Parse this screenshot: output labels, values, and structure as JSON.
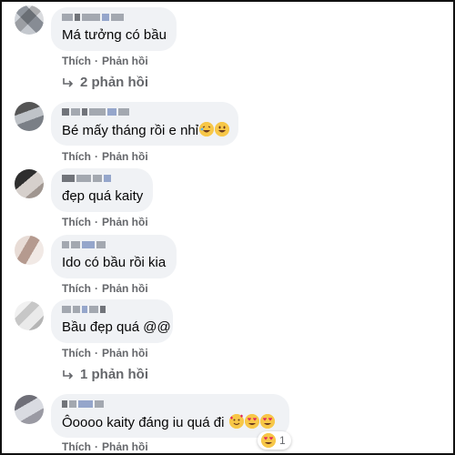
{
  "comments": [
    {
      "text": "Má tưởng có bầu",
      "like": "Thích",
      "reply": "Phản hồi",
      "replies": "2 phản hồi"
    },
    {
      "text": "Bé mấy tháng rồi e nhỉ",
      "like": "Thích",
      "reply": "Phản hồi"
    },
    {
      "text": "đẹp quá kaity",
      "like": "Thích",
      "reply": "Phản hồi"
    },
    {
      "text": "Ido có bầu rồi kia",
      "like": "Thích",
      "reply": "Phản hồi"
    },
    {
      "text": "Bầu đẹp quá @@",
      "like": "Thích",
      "reply": "Phản hồi",
      "replies": "1 phản hồi"
    },
    {
      "text": "Ôoooo kaity đáng iu quá đi",
      "like": "Thích",
      "reply": "Phản hồi",
      "reaction_count": "1"
    }
  ],
  "separator": "·",
  "colors": {
    "bubble": "#f0f2f5",
    "meta": "#65676b",
    "text": "#050505"
  },
  "icons": [
    "reply-arrow-icon",
    "laughing-emoji-icon",
    "grinning-emoji-icon",
    "heart-eyes-emoji-icon"
  ]
}
